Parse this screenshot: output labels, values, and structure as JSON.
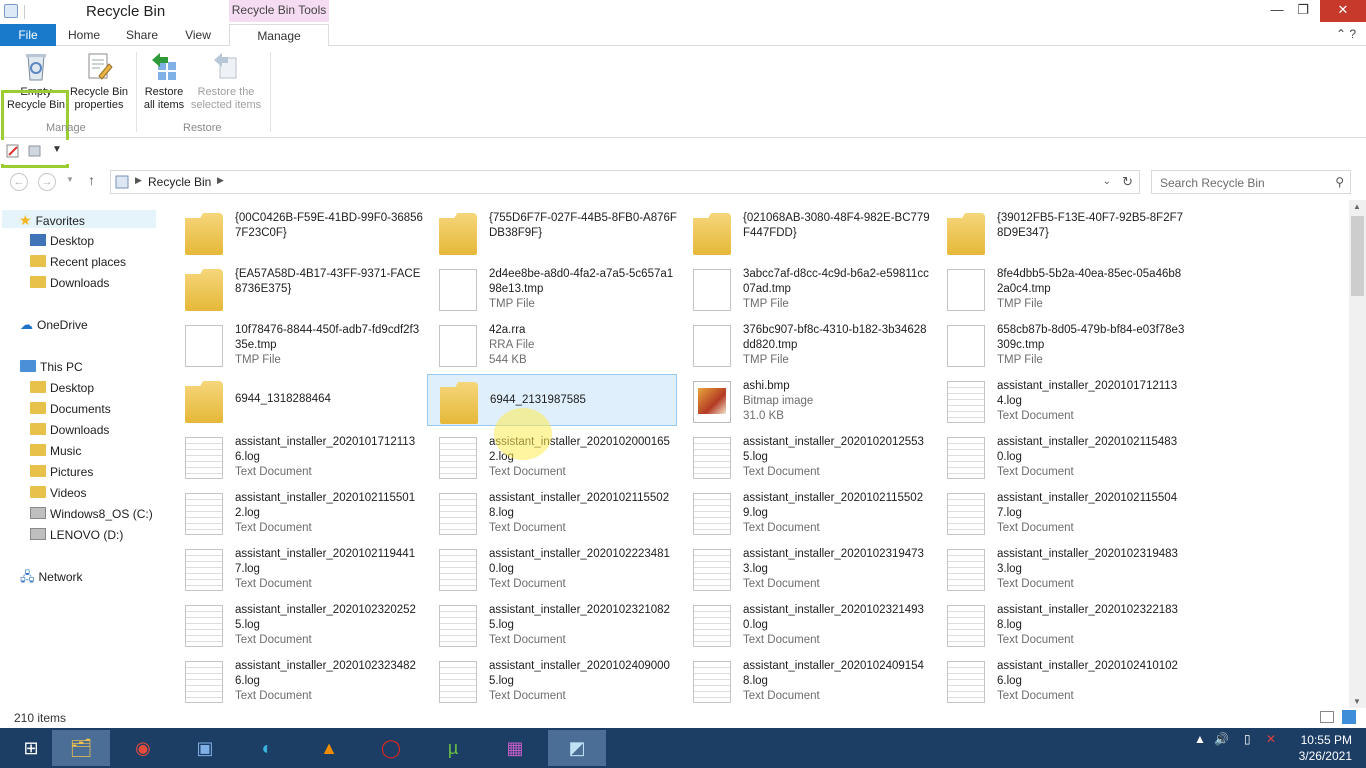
{
  "window": {
    "title": "Recycle Bin",
    "context_tab": "Recycle Bin Tools",
    "minimize": "—",
    "maximize": "❐",
    "close": "✕"
  },
  "tabs": {
    "file": "File",
    "home": "Home",
    "share": "Share",
    "view": "View",
    "manage": "Manage",
    "help": "⌃ ?"
  },
  "ribbon": {
    "empty_l1": "Empty",
    "empty_l2": "Recycle Bin",
    "props_l1": "Recycle Bin",
    "props_l2": "properties",
    "restore_all_l1": "Restore",
    "restore_all_l2": "all items",
    "restore_sel_l1": "Restore the",
    "restore_sel_l2": "selected items",
    "group_manage": "Manage",
    "group_restore": "Restore"
  },
  "address": {
    "path": "Recycle Bin",
    "search_placeholder": "Search Recycle Bin"
  },
  "navpane": {
    "favorites": "Favorites",
    "desktop": "Desktop",
    "recent": "Recent places",
    "downloads": "Downloads",
    "onedrive": "OneDrive",
    "thispc": "This PC",
    "pc_desktop": "Desktop",
    "documents": "Documents",
    "pc_downloads": "Downloads",
    "music": "Music",
    "pictures": "Pictures",
    "videos": "Videos",
    "c_drive": "Windows8_OS (C:)",
    "d_drive": "LENOVO (D:)",
    "network": "Network"
  },
  "items": [
    {
      "name": "{00C0426B-F59E-41BD-99F0-368567F23C0F}",
      "sub": "",
      "kind": "folder"
    },
    {
      "name": "{755D6F7F-027F-44B5-8FB0-A876FDB38F9F}",
      "sub": "",
      "kind": "folder"
    },
    {
      "name": "{021068AB-3080-48F4-982E-BC779F447FDD}",
      "sub": "",
      "kind": "folder"
    },
    {
      "name": "{39012FB5-F13E-40F7-92B5-8F2F78D9E347}",
      "sub": "",
      "kind": "folder"
    },
    {
      "name": "{EA57A58D-4B17-43FF-9371-FACE8736E375}",
      "sub": "",
      "kind": "folder"
    },
    {
      "name": "2d4ee8be-a8d0-4fa2-a7a5-5c657a198e13.tmp",
      "sub": "TMP File",
      "kind": "doc"
    },
    {
      "name": "3abcc7af-d8cc-4c9d-b6a2-e59811cc07ad.tmp",
      "sub": "TMP File",
      "kind": "doc"
    },
    {
      "name": "8fe4dbb5-5b2a-40ea-85ec-05a46b82a0c4.tmp",
      "sub": "TMP File",
      "kind": "doc"
    },
    {
      "name": "10f78476-8844-450f-adb7-fd9cdf2f335e.tmp",
      "sub": "TMP File",
      "kind": "doc"
    },
    {
      "name": "42a.rra",
      "sub": "RRA File",
      "sub2": "544 KB",
      "kind": "doc"
    },
    {
      "name": "376bc907-bf8c-4310-b182-3b34628dd820.tmp",
      "sub": "TMP File",
      "kind": "doc"
    },
    {
      "name": "658cb87b-8d05-479b-bf84-e03f78e3309c.tmp",
      "sub": "TMP File",
      "kind": "doc"
    },
    {
      "name": "6944_1318288464",
      "sub": "",
      "kind": "folder"
    },
    {
      "name": "6944_2131987585",
      "sub": "",
      "kind": "folder",
      "selected": true
    },
    {
      "name": "ashi.bmp",
      "sub": "Bitmap image",
      "sub2": "31.0 KB",
      "kind": "bmp"
    },
    {
      "name": "assistant_installer_20201017121134.log",
      "sub": "Text Document",
      "kind": "txt"
    },
    {
      "name": "assistant_installer_20201017121136.log",
      "sub": "Text Document",
      "kind": "txt"
    },
    {
      "name": "assistant_installer_20201020001652.log",
      "sub": "Text Document",
      "kind": "txt"
    },
    {
      "name": "assistant_installer_20201020125535.log",
      "sub": "Text Document",
      "kind": "txt"
    },
    {
      "name": "assistant_installer_20201021154830.log",
      "sub": "Text Document",
      "kind": "txt"
    },
    {
      "name": "assistant_installer_20201021155012.log",
      "sub": "Text Document",
      "kind": "txt"
    },
    {
      "name": "assistant_installer_20201021155028.log",
      "sub": "Text Document",
      "kind": "txt"
    },
    {
      "name": "assistant_installer_20201021155029.log",
      "sub": "Text Document",
      "kind": "txt"
    },
    {
      "name": "assistant_installer_20201021155047.log",
      "sub": "Text Document",
      "kind": "txt"
    },
    {
      "name": "assistant_installer_20201021194417.log",
      "sub": "Text Document",
      "kind": "txt"
    },
    {
      "name": "assistant_installer_20201022234810.log",
      "sub": "Text Document",
      "kind": "txt"
    },
    {
      "name": "assistant_installer_20201023194733.log",
      "sub": "Text Document",
      "kind": "txt"
    },
    {
      "name": "assistant_installer_20201023194833.log",
      "sub": "Text Document",
      "kind": "txt"
    },
    {
      "name": "assistant_installer_20201023202525.log",
      "sub": "Text Document",
      "kind": "txt"
    },
    {
      "name": "assistant_installer_20201023210825.log",
      "sub": "Text Document",
      "kind": "txt"
    },
    {
      "name": "assistant_installer_20201023214930.log",
      "sub": "Text Document",
      "kind": "txt"
    },
    {
      "name": "assistant_installer_20201023221838.log",
      "sub": "Text Document",
      "kind": "txt"
    },
    {
      "name": "assistant_installer_20201023234826.log",
      "sub": "Text Document",
      "kind": "txt"
    },
    {
      "name": "assistant_installer_20201024090005.log",
      "sub": "Text Document",
      "kind": "txt"
    },
    {
      "name": "assistant_installer_20201024091548.log",
      "sub": "Text Document",
      "kind": "txt"
    },
    {
      "name": "assistant_installer_20201024101026.log",
      "sub": "Text Document",
      "kind": "txt"
    }
  ],
  "status": {
    "count": "210 items"
  },
  "taskbar": {
    "time": "10:55 PM",
    "date": "3/26/2021"
  },
  "colors": {
    "accent": "#1979ca",
    "taskbar": "#1c3d64",
    "highlight": "#9acd32",
    "selection": "#dfeffc"
  }
}
